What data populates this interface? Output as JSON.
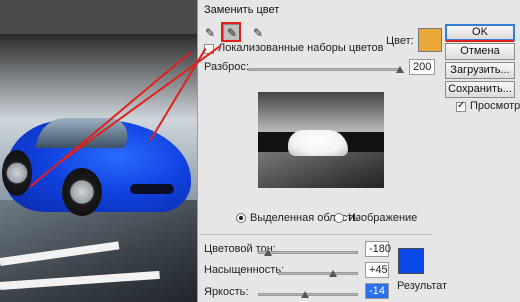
{
  "window": {
    "title": "Заменить цвет"
  },
  "tools": {
    "names": [
      "eyedropper-icon",
      "eyedropper-plus-icon",
      "eyedropper-minus-icon"
    ]
  },
  "localized": {
    "label": "Локализованные наборы цветов",
    "checked": false
  },
  "color": {
    "label": "Цвет:",
    "value": "#e8a83a"
  },
  "fuzziness": {
    "label": "Разброс:",
    "value": "200"
  },
  "view": {
    "option_selection": "Выделенная область",
    "option_image": "Изображение",
    "selected": "selection"
  },
  "hue": {
    "label": "Цветовой тон:",
    "value": "-180"
  },
  "saturation": {
    "label": "Насыщенность:",
    "value": "+45"
  },
  "lightness": {
    "label": "Яркость:",
    "value": "-14"
  },
  "result": {
    "label": "Результат",
    "value": "#0a47e8"
  },
  "buttons": {
    "ok": "OK",
    "cancel": "Отмена",
    "load": "Загрузить...",
    "save": "Сохранить..."
  },
  "preview_option": {
    "label": "Просмотр",
    "checked": true
  },
  "accent": {
    "annotation": "#e0201c",
    "focus": "#3a7bd5"
  }
}
